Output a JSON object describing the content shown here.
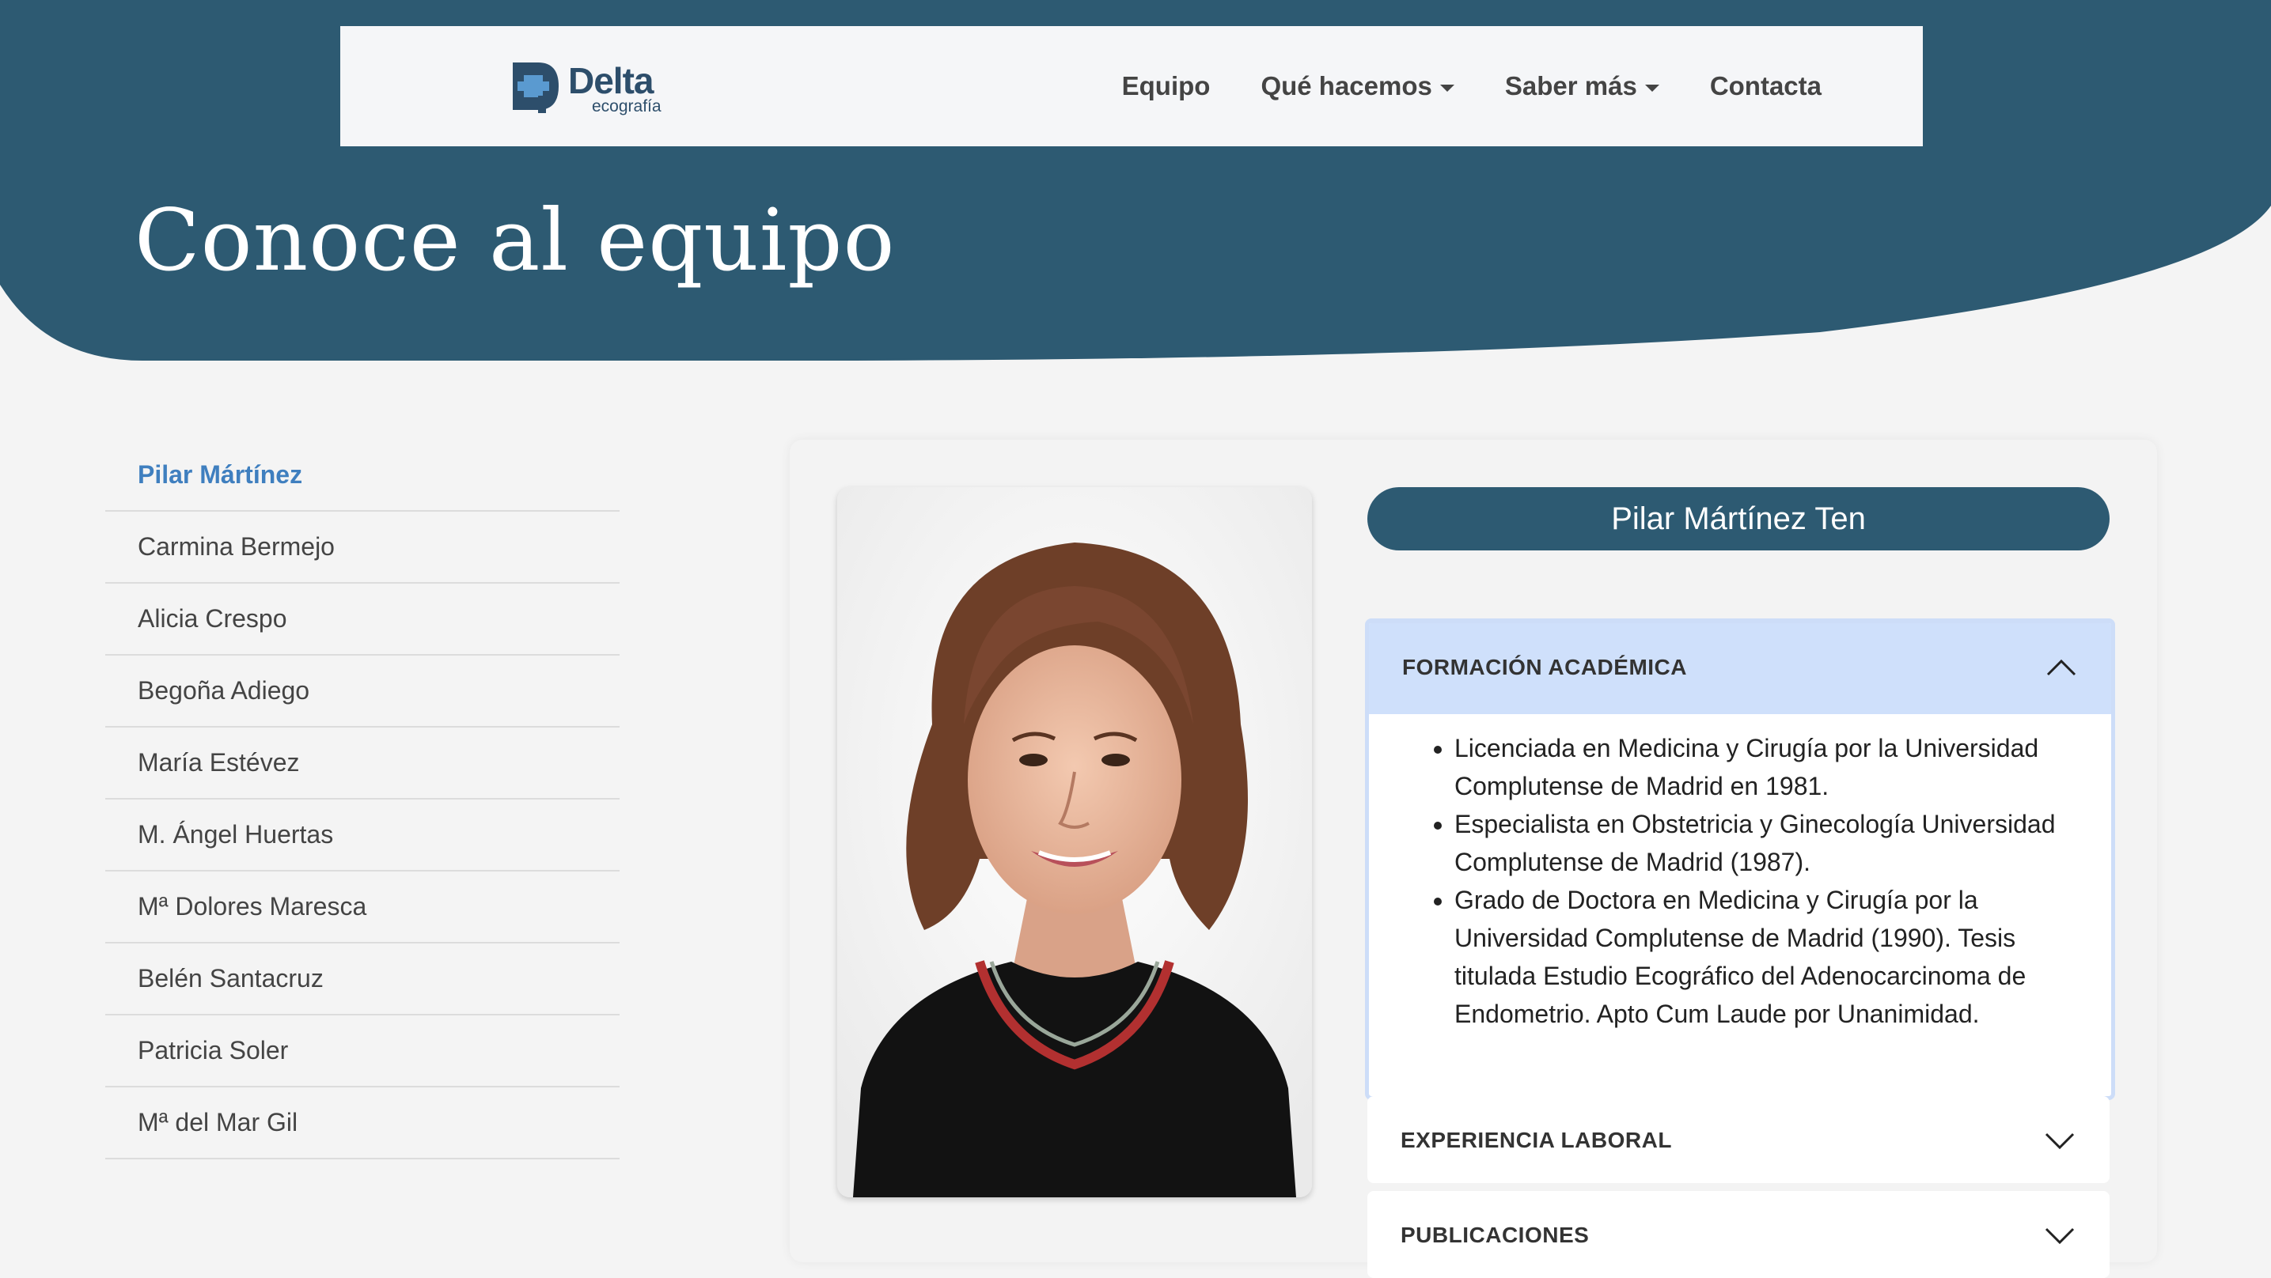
{
  "brand": {
    "name": "Delta",
    "tagline": "ecografía"
  },
  "nav": {
    "items": [
      {
        "label": "Equipo",
        "dropdown": false
      },
      {
        "label": "Qué hacemos",
        "dropdown": true
      },
      {
        "label": "Saber más",
        "dropdown": true
      },
      {
        "label": "Contacta",
        "dropdown": false
      }
    ]
  },
  "hero": {
    "title": "Conoce al equipo"
  },
  "team": {
    "members": [
      {
        "name": "Pilar Mártínez",
        "active": true
      },
      {
        "name": "Carmina Bermejo",
        "active": false
      },
      {
        "name": "Alicia Crespo",
        "active": false
      },
      {
        "name": "Begoña Adiego",
        "active": false
      },
      {
        "name": "María Estévez",
        "active": false
      },
      {
        "name": "M. Ángel Huertas",
        "active": false
      },
      {
        "name": "Mª Dolores Maresca",
        "active": false
      },
      {
        "name": "Belén Santacruz",
        "active": false
      },
      {
        "name": "Patricia Soler",
        "active": false
      },
      {
        "name": "Mª del Mar Gil",
        "active": false
      }
    ]
  },
  "profile": {
    "full_name": "Pilar Mártínez Ten",
    "sections": [
      {
        "title": "FORMACIÓN ACADÉMICA",
        "expanded": true,
        "items": [
          "Licenciada en Medicina y Cirugía por la Universidad Complutense de Madrid en 1981.",
          "Especialista en Obstetricia y Ginecología Universidad Complutense de Madrid (1987).",
          "Grado de Doctora en Medicina y Cirugía por la Universidad Complutense de Madrid (1990). Tesis titulada Estudio Ecográfico del Adenocarcinoma de Endometrio. Apto Cum Laude por Unanimidad."
        ]
      },
      {
        "title": "EXPERIENCIA LABORAL",
        "expanded": false
      },
      {
        "title": "PUBLICACIONES",
        "expanded": false
      }
    ]
  },
  "colors": {
    "primary": "#2d5a72",
    "accent_link": "#3f7fbf",
    "accordion_active": "#cfe0fb",
    "page_bg": "#f4f4f4"
  }
}
